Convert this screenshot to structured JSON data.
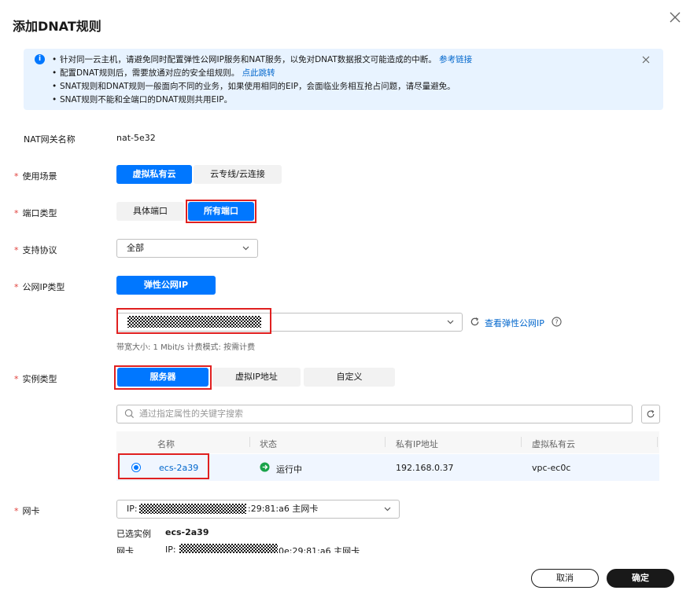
{
  "dialog": {
    "title": "添加DNAT规则"
  },
  "notice": {
    "lines": [
      "针对同一云主机，请避免同时配置弹性公网IP服务和NAT服务，以免对DNAT数据报文可能造成的中断。",
      "配置DNAT规则后，需要放通对应的安全组规则。",
      "SNAT规则和DNAT规则一般面向不同的业务，如果使用相同的EIP，会面临业务相互抢占问题，请尽量避免。",
      "SNAT规则不能和全端口的DNAT规则共用EIP。"
    ],
    "link1": "参考链接",
    "link2": "点此跳转"
  },
  "form": {
    "gateway_label": "NAT网关名称",
    "gateway_value": "nat-5e32",
    "scenario_label": "使用场景",
    "scenario_options": [
      "虚拟私有云",
      "云专线/云连接"
    ],
    "port_type_label": "端口类型",
    "port_type_options": [
      "具体端口",
      "所有端口"
    ],
    "protocol_label": "支持协议",
    "protocol_value": "全部",
    "public_ip_type_label": "公网IP类型",
    "public_ip_type_option": "弹性公网IP",
    "view_eip_link": "查看弹性公网IP",
    "bandwidth_hint": "带宽大小: 1 Mbit/s 计费模式: 按需计费",
    "instance_type_label": "实例类型",
    "instance_type_options": [
      "服务器",
      "虚拟IP地址",
      "自定义"
    ],
    "search_placeholder": "通过指定属性的关键字搜索",
    "nic_label": "网卡",
    "nic_prefix": "IP:",
    "nic_suffix": ":29:81:a6 主网卡",
    "selected_instance_label": "已选实例",
    "selected_instance_value": "ecs-2a39",
    "selected_nic_label": "网卡",
    "selected_nic_prefix": "IP:",
    "selected_nic_suffix": "0e:29:81:a6 主网卡"
  },
  "table": {
    "headers": [
      "名称",
      "状态",
      "私有IP地址",
      "虚拟私有云"
    ],
    "rows": [
      {
        "name": "ecs-2a39",
        "status": "运行中",
        "ip": "192.168.0.37",
        "vpc": "vpc-ec0c"
      }
    ]
  },
  "footer": {
    "cancel": "取消",
    "confirm": "确定"
  },
  "colors": {
    "accent": "#0077ff",
    "highlight": "#e02020",
    "running": "#1aa34a",
    "notice_bg": "#e8f3ff"
  }
}
